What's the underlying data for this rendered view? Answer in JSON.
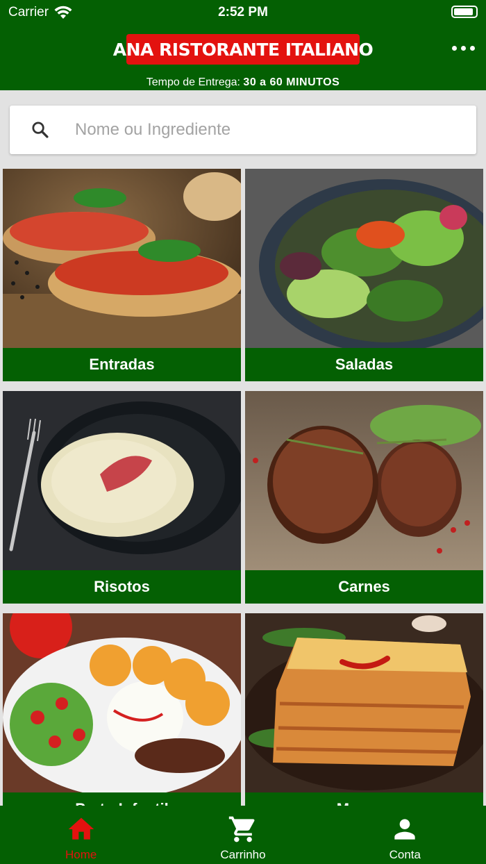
{
  "status_bar": {
    "carrier": "Carrier",
    "time": "2:52 PM",
    "battery_level": 0.9
  },
  "header": {
    "logo_text": "ANA RISTORANTE ITALIANO",
    "delivery_label": "Tempo de Entrega:",
    "delivery_value": "30 a 60 MINUTOS",
    "menu_icon": "more-horizontal-icon"
  },
  "search": {
    "placeholder": "Nome ou Ingrediente",
    "value": "",
    "icon": "search-icon"
  },
  "categories": [
    {
      "label": "Entradas"
    },
    {
      "label": "Saladas"
    },
    {
      "label": "Risotos"
    },
    {
      "label": "Carnes"
    },
    {
      "label": "Prato Infantil"
    },
    {
      "label": "Massas"
    }
  ],
  "tabbar": {
    "items": [
      {
        "label": "Home",
        "icon": "home-icon",
        "active": true
      },
      {
        "label": "Carrinho",
        "icon": "cart-icon",
        "active": false
      },
      {
        "label": "Conta",
        "icon": "account-icon",
        "active": false
      }
    ]
  },
  "colors": {
    "primary": "#046003",
    "accent": "#e3120f",
    "background": "#e2e2e2"
  }
}
